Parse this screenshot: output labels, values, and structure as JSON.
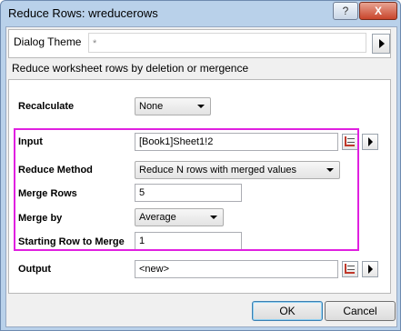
{
  "window": {
    "title": "Reduce Rows: wreducerows",
    "help_label": "?",
    "close_label": "X"
  },
  "theme": {
    "label": "Dialog Theme",
    "value": "*"
  },
  "description": "Reduce worksheet rows by deletion or mergence",
  "fields": {
    "recalculate": {
      "label": "Recalculate",
      "value": "None"
    },
    "input": {
      "label": "Input",
      "value": "[Book1]Sheet1!2"
    },
    "reduce_method": {
      "label": "Reduce Method",
      "value": "Reduce N rows with merged values"
    },
    "merge_rows": {
      "label": "Merge Rows",
      "value": "5"
    },
    "merge_by": {
      "label": "Merge by",
      "value": "Average"
    },
    "starting_row": {
      "label": "Starting Row to Merge",
      "value": "1"
    },
    "output": {
      "label": "Output",
      "value": "<new>"
    }
  },
  "buttons": {
    "ok": "OK",
    "cancel": "Cancel"
  }
}
